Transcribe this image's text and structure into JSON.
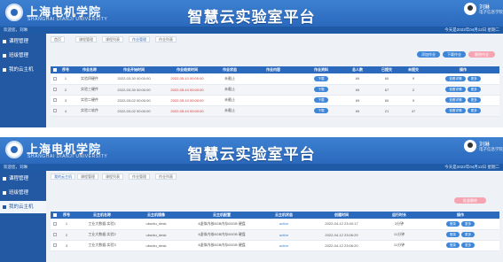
{
  "colors": {
    "header": "#2b69bd",
    "sidebar": "#2358a3",
    "accent": "#3d86d8",
    "danger": "#e0302d",
    "pink_button": "#f6a3b2"
  },
  "header": {
    "school_name": "上海电机学院",
    "school_name_en": "SHANGHAI DIANJI UNIVERSITY",
    "platform_title": "智慧云实验室平台",
    "user_name": "刘琳",
    "user_role": "电子信息学院",
    "sub_left": "欢迎您，刘琳",
    "sub_right": "今天是2022年04月12日 星期二"
  },
  "sidebar": {
    "items": [
      {
        "label": "课程管理"
      },
      {
        "label": "班级管理"
      },
      {
        "label": "我的云主机"
      }
    ]
  },
  "screen1": {
    "tabs": [
      {
        "label": "首页"
      },
      {
        "label": "课程管理"
      },
      {
        "label": "课程列表"
      },
      {
        "label": "作业管理"
      },
      {
        "label": "作业列表"
      }
    ],
    "toolbar": {
      "add_label": "添加作业",
      "download_label": "下载作业",
      "delete_label": "删除作业"
    },
    "columns": [
      "序号",
      "作业名称",
      "作业开始时间",
      "作业结束时间",
      "作业状态",
      "作业内容",
      "作业资料",
      "总人数",
      "已提交",
      "未提交",
      "操作"
    ],
    "rows": [
      {
        "no": "1",
        "name": "实验四硬件",
        "start": "2022-03-30 00:00:00",
        "end": "2022-05-10 00:00:00",
        "status": "未截止",
        "file": "下载",
        "total": "69",
        "submitted": "60",
        "unsubmitted": "9"
      },
      {
        "no": "2",
        "name": "实验三硬件",
        "start": "2022-03-30 00:00:00",
        "end": "2022-05-10 00:00:00",
        "status": "未截止",
        "file": "下载",
        "total": "69",
        "submitted": "67",
        "unsubmitted": "2"
      },
      {
        "no": "3",
        "name": "实验二硬件",
        "start": "2022-03-02 00:00:00",
        "end": "2022-05-10 00:00:00",
        "status": "未截止",
        "file": "下载",
        "total": "69",
        "submitted": "60",
        "unsubmitted": "9"
      },
      {
        "no": "4",
        "name": "实验二软件",
        "start": "2022-03-02 00:00:00",
        "end": "2022-05-10 00:00:00",
        "status": "未截止",
        "file": "下载",
        "total": "69",
        "submitted": "21",
        "unsubmitted": "47"
      }
    ],
    "row_action": "查看详情",
    "row_action2": "更多"
  },
  "screen2": {
    "tabs": [
      {
        "label": "我的云主机"
      },
      {
        "label": "课程管理"
      },
      {
        "label": "课程列表"
      },
      {
        "label": "作业管理"
      },
      {
        "label": "作业列表"
      }
    ],
    "toolbar": {
      "delete_label": "批量删除"
    },
    "columns": [
      "序号",
      "云主机名称",
      "云主机镜像",
      "云主机配置",
      "云主机状态",
      "创建时间",
      "运行时长",
      "操作"
    ],
    "rows": [
      {
        "no": "1",
        "name": "工业大数据-实验1",
        "image": "ubuntu_desk",
        "config": "4虚拟内核8GB内存60GB 硬盘",
        "status": "active",
        "created": "2022-04-12 23:40:17",
        "duration": "3分钟"
      },
      {
        "no": "2",
        "name": "工业大数据-实验2",
        "image": "ubuntu_desk",
        "config": "4虚拟内核8GB内存60GB 硬盘",
        "status": "active",
        "created": "2022-04-12 23:06:29",
        "duration": "11分钟"
      },
      {
        "no": "3",
        "name": "工业大数据-实验3",
        "image": "ubuntu_desk",
        "config": "4虚拟内核8GB内存60GB 硬盘",
        "status": "active",
        "created": "2022-04-12 23:06:20",
        "duration": "11分钟"
      }
    ],
    "row_action": "登录",
    "row_action2": "更多"
  }
}
